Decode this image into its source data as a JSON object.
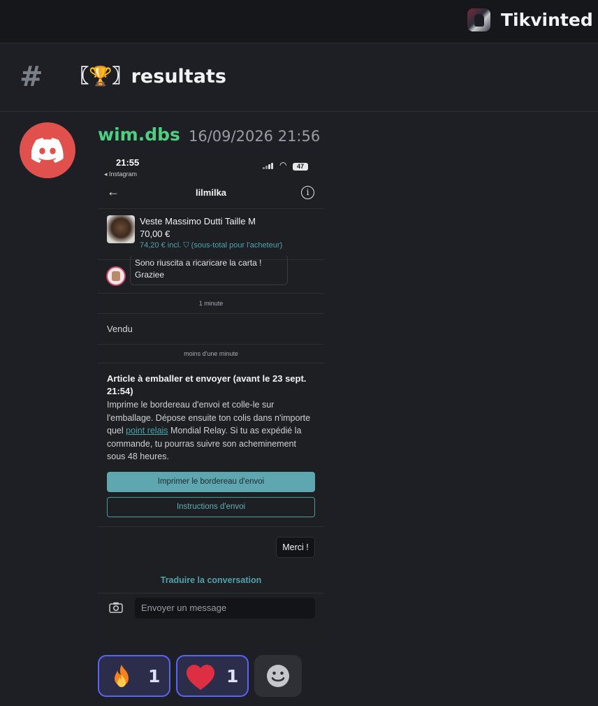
{
  "server": {
    "name": "Tikvinted",
    "avatar_icon": "server-avatar"
  },
  "channel": {
    "hash": "#",
    "name": "〖🏆〗resultats"
  },
  "message": {
    "author": "wim.dbs",
    "author_color": "#4fcf82",
    "timestamp": "16/09/2026 21:56",
    "avatar_color": "#e0514d",
    "avatar_icon": "discord-logo-icon",
    "attachment": {
      "status_bar": {
        "time": "21:55",
        "back_app": "◂ Instagram",
        "battery": "47"
      },
      "conversation_title": "lilmilka",
      "item": {
        "title": "Veste Massimo Dutti Taille M",
        "price": "70,00 €",
        "incl": "74,20 € incl. ⛉ (sous-total pour l'acheteur)"
      },
      "incoming_message": "Sono riuscita a ricaricare la carta ! Graziee",
      "time_1": "1 minute",
      "status_sold": "Vendu",
      "time_2": "moins d'une minute",
      "article_title": "Article à emballer et envoyer (avant le 23 sept. 21:54)",
      "article_body_1": "Imprime le bordereau d'envoi et colle-le sur l'emballage. Dépose ensuite ton colis dans n'importe quel ",
      "article_link": "point relais",
      "article_body_2": " Mondial Relay. Si tu as expédié la commande, tu pourras suivre son acheminement sous 48 heures.",
      "btn_print": "Imprimer le bordereau d'envoi",
      "btn_instructions": "Instructions d'envoi",
      "outgoing_message": "Merci !",
      "translate": "Traduire la conversation",
      "input_placeholder": "Envoyer un message",
      "accent_color": "#4ea3ac"
    }
  },
  "reactions": [
    {
      "emoji": "fire",
      "count": "1"
    },
    {
      "emoji": "red-heart",
      "count": "1"
    }
  ],
  "add_reaction_icon": "smiley-icon"
}
